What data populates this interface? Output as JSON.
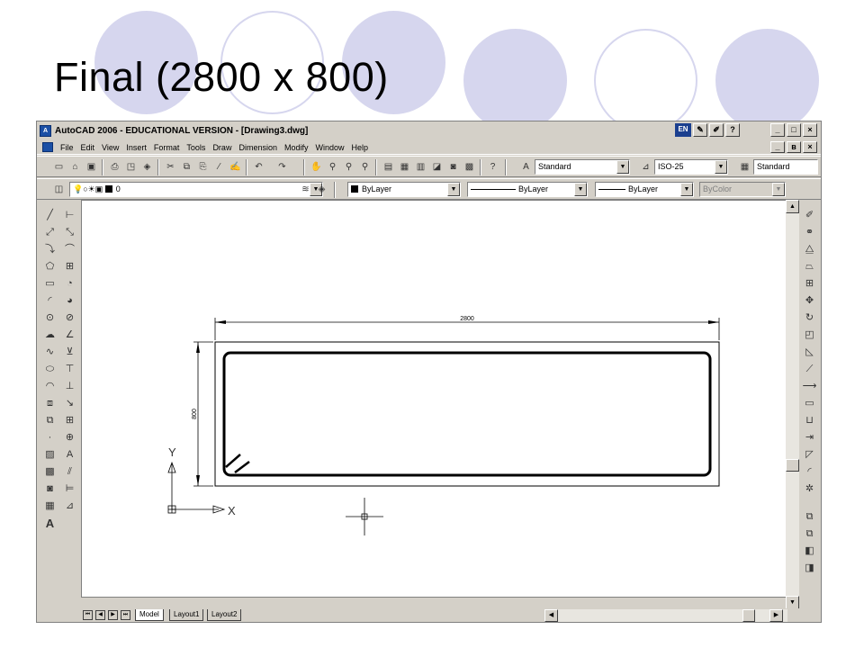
{
  "slide": {
    "title": "Final (2800 x 800)"
  },
  "window": {
    "title": "AutoCAD 2006 - EDUCATIONAL VERSION - [Drawing3.dwg]",
    "lang": "EN",
    "minimize": "_",
    "maximize": "□",
    "close": "×",
    "restore": "ʙ"
  },
  "menu": [
    "File",
    "Edit",
    "View",
    "Insert",
    "Format",
    "Tools",
    "Draw",
    "Dimension",
    "Modify",
    "Window",
    "Help"
  ],
  "toolbar": {
    "text_style": "Standard",
    "dim_style": "ISO-25",
    "table_style": "Standard",
    "layer": "0",
    "color": "ByLayer",
    "linetype": "ByLayer",
    "lineweight": "ByLayer",
    "plotstyle": "ByColor"
  },
  "drawing": {
    "horizontal_dimension": "2800",
    "vertical_dimension": "800",
    "ucs_x_label": "X",
    "ucs_y_label": "Y"
  },
  "layout_tabs": [
    "Model",
    "Layout1",
    "Layout2"
  ],
  "colors": {
    "circle": "#d6d6ee",
    "window_bg": "#d4d0c8",
    "title_text": "#000000"
  }
}
